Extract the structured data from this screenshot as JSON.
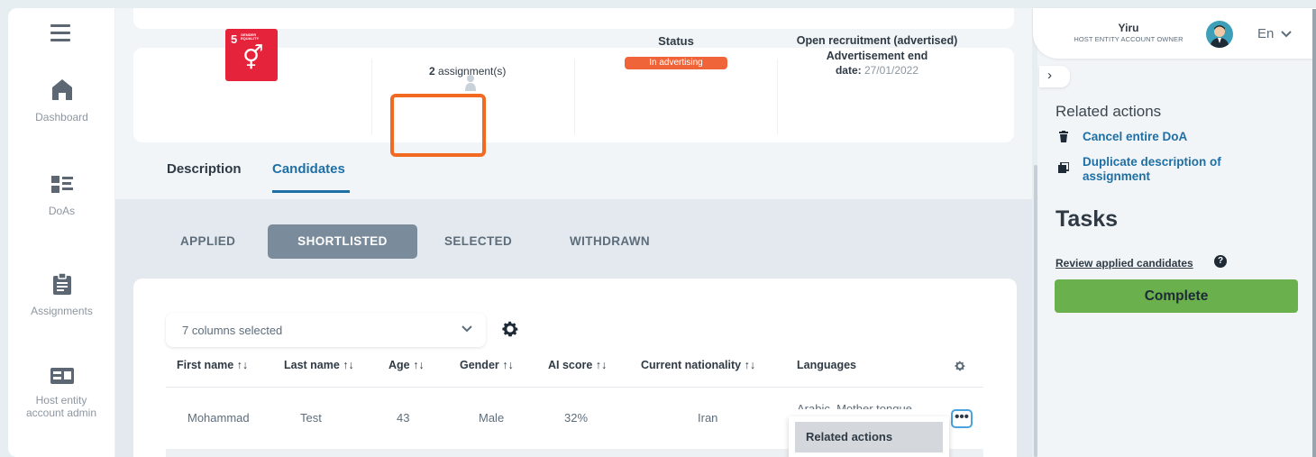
{
  "sidebar": {
    "menu_icon": "hamburger-icon",
    "items": [
      {
        "label": "Dashboard",
        "icon": "home-icon"
      },
      {
        "label": "DoAs",
        "icon": "list-icon"
      },
      {
        "label": "Assignments",
        "icon": "clipboard-icon"
      },
      {
        "label": "Host entity account admin",
        "icon": "id-card-icon"
      }
    ]
  },
  "summary": {
    "sdg": {
      "number": "5",
      "text": "GENDER EQUALITY",
      "symbol": "⚥",
      "color": "#e5243b"
    },
    "assignments_count": "2",
    "assignments_label": " assignment(s)",
    "status_title": "Status",
    "status_badge": "In advertising",
    "recruitment_title": "Open recruitment (advertised)",
    "advertisement_label": "Advertisement end",
    "date_label": "date:",
    "date_value": " 27/01/2022"
  },
  "tabs": {
    "description": "Description",
    "candidates": "Candidates"
  },
  "subtabs": {
    "applied": "APPLIED",
    "shortlisted": "SHORTLISTED",
    "selected": "SELECTED",
    "withdrawn": "WITHDRAWN"
  },
  "table": {
    "columns_selected": "7 columns selected",
    "headers": [
      "First name ↑↓",
      "Last name ↑↓",
      "Age ↑↓",
      "Gender ↑↓",
      "AI score ↑↓",
      "Current nationality ↑↓",
      "Languages"
    ],
    "rows": [
      {
        "first_name": "Mohammad",
        "last_name": "Test",
        "age": "43",
        "gender": "Male",
        "ai_score": "32%",
        "nationality": "Iran",
        "languages": "Arabic, Mother tongue"
      }
    ],
    "row_menu": {
      "dots": "•••",
      "item": "Related actions"
    }
  },
  "user": {
    "name": "Yiru",
    "role": "HOST ENTITY ACCOUNT OWNER",
    "language": "En"
  },
  "right_panel": {
    "related_title": "Related actions",
    "cancel_label": "Cancel entire DoA",
    "duplicate_label": "Duplicate description of assignment",
    "tasks_title": "Tasks",
    "review_label": "Review applied candidates",
    "complete_label": "Complete"
  },
  "colors": {
    "accent": "#1d6fa5",
    "status": "#f0643a",
    "complete": "#6ab04c",
    "highlight": "#f26a21"
  }
}
